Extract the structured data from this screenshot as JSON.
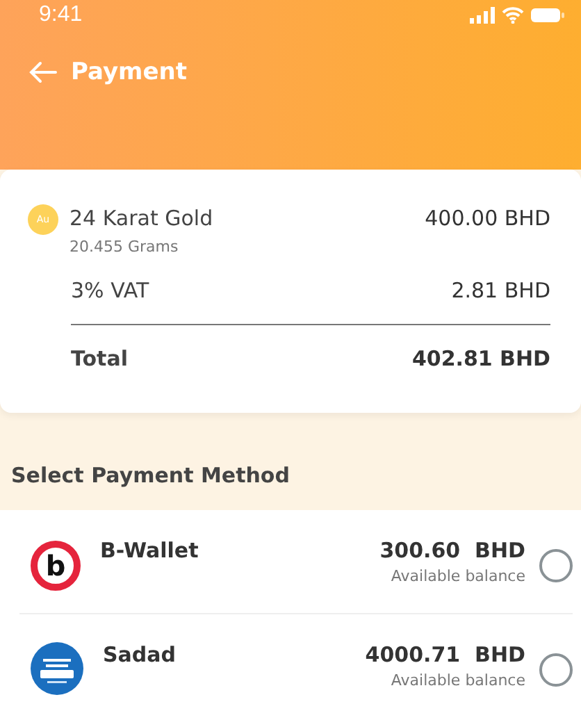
{
  "status_bar": {
    "time": "9:41"
  },
  "header": {
    "title": "Payment"
  },
  "summary": {
    "item": {
      "badge": "Au",
      "name": "24 Karat Gold",
      "weight": "20.455 Grams",
      "amount": "400.00 BHD"
    },
    "vat": {
      "label": "3% VAT",
      "amount": "2.81 BHD"
    },
    "total": {
      "label": "Total",
      "amount": "402.81 BHD"
    }
  },
  "section_title": "Select Payment Method",
  "methods": [
    {
      "kind": "bwallet",
      "logo_letter": "b",
      "name": "B-Wallet",
      "balance": "300.60  BHD",
      "balance_label": "Available balance",
      "selected": false
    },
    {
      "kind": "sadad",
      "name": "Sadad",
      "balance": "4000.71  BHD",
      "balance_label": "Available balance",
      "selected": false
    }
  ]
}
